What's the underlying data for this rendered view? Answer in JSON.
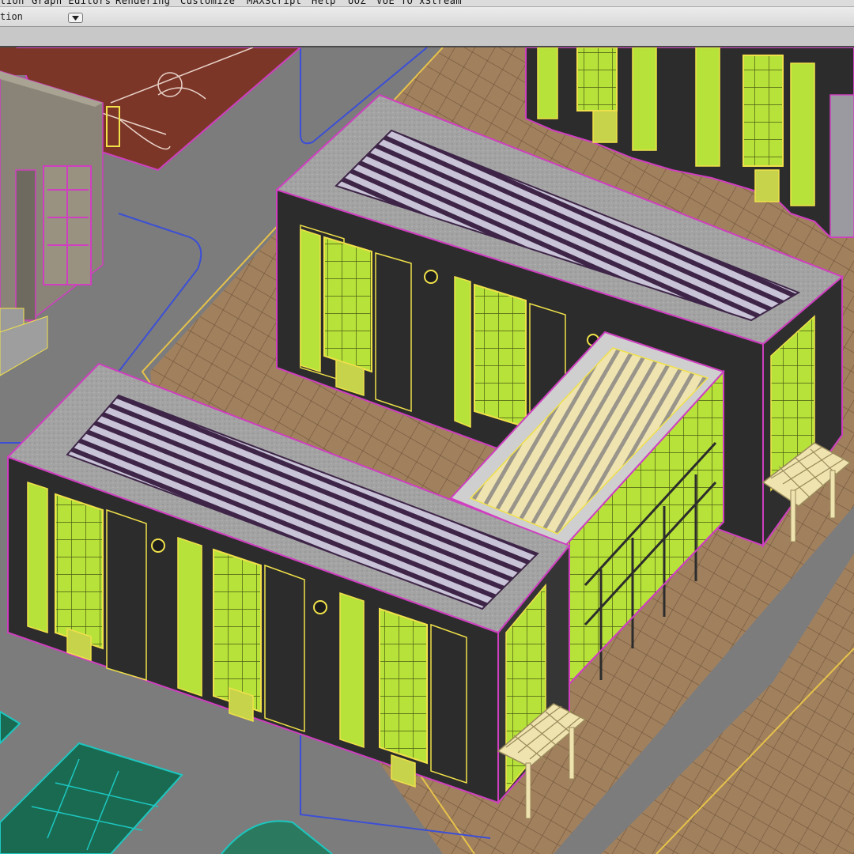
{
  "menubar": {
    "items": [
      {
        "label": "tion"
      },
      {
        "label": "Graph Editors"
      },
      {
        "label": "Rendering"
      },
      {
        "label": "Customize"
      },
      {
        "label": "MAXScript"
      },
      {
        "label": "Help"
      },
      {
        "label": "UOZ"
      },
      {
        "label": "VUE TO xStream"
      }
    ]
  },
  "toolbar": {
    "selection_label": "tion"
  },
  "icons": {
    "dropdown": "chevron-down-icon"
  },
  "colors": {
    "wall_green": "#b7e23a",
    "wall_dark": "#2c2c2c",
    "outline_magenta": "#e04bd6",
    "outline_yellow": "#f0e14a",
    "roof_gray": "#9e9e9e",
    "roof_purple": "#4a2a55",
    "paving": "#a1805e",
    "court_red": "#7b3628",
    "court_cyan": "#1cc7c0",
    "road": "#7c7c7c"
  }
}
